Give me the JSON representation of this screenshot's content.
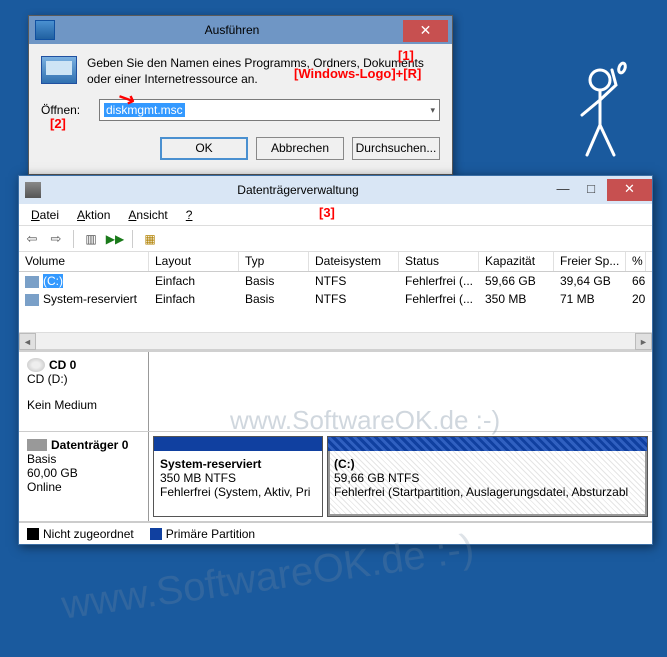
{
  "run_dialog": {
    "title": "Ausführen",
    "description": "Geben Sie den Namen eines Programms, Ordners, Dokuments oder einer Internetressource an.",
    "open_label": "Öffnen:",
    "command": "diskmgmt.msc",
    "buttons": {
      "ok": "OK",
      "cancel": "Abbrechen",
      "browse": "Durchsuchen..."
    }
  },
  "annotations": {
    "a1": "[1]",
    "a1_hint": "[Windows-Logo]+[R]",
    "a2": "[2]",
    "a3": "[3]"
  },
  "disk_mgmt": {
    "title": "Datenträgerverwaltung",
    "menu": {
      "datei": "Datei",
      "aktion": "Aktion",
      "ansicht": "Ansicht",
      "hilfe": "?"
    },
    "columns": {
      "volume": "Volume",
      "layout": "Layout",
      "typ": "Typ",
      "fs": "Dateisystem",
      "status": "Status",
      "kap": "Kapazität",
      "frei": "Freier Sp...",
      "pct": "%"
    },
    "volumes": [
      {
        "name": "(C:)",
        "layout": "Einfach",
        "typ": "Basis",
        "fs": "NTFS",
        "status": "Fehlerfrei (...",
        "kap": "59,66 GB",
        "frei": "39,64 GB",
        "pct": "66"
      },
      {
        "name": "System-reserviert",
        "layout": "Einfach",
        "typ": "Basis",
        "fs": "NTFS",
        "status": "Fehlerfrei (...",
        "kap": "350 MB",
        "frei": "71 MB",
        "pct": "20"
      }
    ],
    "cd0": {
      "title": "CD 0",
      "sub": "CD (D:)",
      "state": "Kein Medium"
    },
    "disk0": {
      "title": "Datenträger 0",
      "type": "Basis",
      "size": "60,00 GB",
      "state": "Online",
      "parts": [
        {
          "name": "System-reserviert",
          "size": "350 MB NTFS",
          "status": "Fehlerfrei (System, Aktiv, Pri"
        },
        {
          "name": "(C:)",
          "size": "59,66 GB NTFS",
          "status": "Fehlerfrei (Startpartition, Auslagerungsdatei, Absturzabl"
        }
      ]
    },
    "legend": {
      "unalloc": "Nicht zugeordnet",
      "primary": "Primäre Partition"
    }
  },
  "watermark": "www.SoftwareOK.de :-)"
}
